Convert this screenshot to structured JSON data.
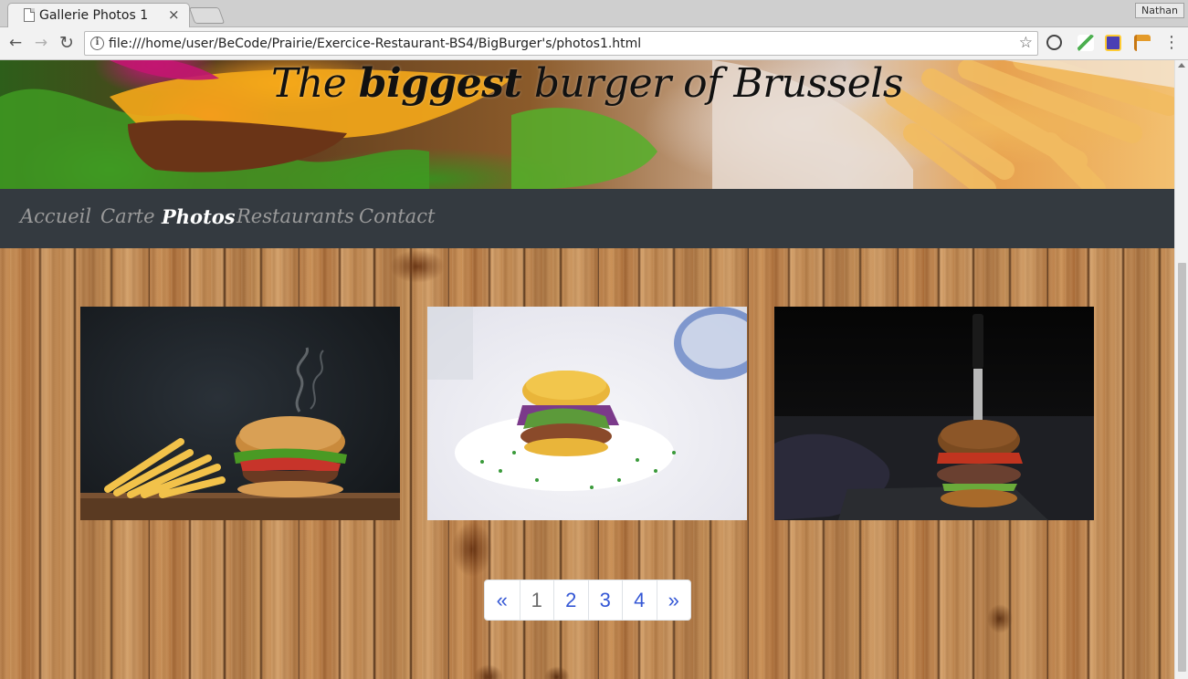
{
  "browser": {
    "tab_title": "Gallerie Photos 1",
    "tab_close": "×",
    "profile_name": "Nathan",
    "url": "file:///home/user/BeCode/Prairie/Exercice-Restaurant-BS4/BigBurger's/photos1.html",
    "icons": {
      "back": "←",
      "forward": "→",
      "reload": "↻",
      "info": "i",
      "star": "☆",
      "menu": "⋮"
    }
  },
  "header": {
    "title_start": "The",
    "title_emphasis": "biggest",
    "title_end": "burger of Brussels"
  },
  "nav": {
    "items": [
      {
        "label": "Accueil",
        "active": false
      },
      {
        "label": "Carte",
        "active": false
      },
      {
        "label": "Photos",
        "active": true
      },
      {
        "label": "Restaurants",
        "active": false
      },
      {
        "label": "Contact",
        "active": false
      }
    ]
  },
  "pagination": {
    "prev": "«",
    "pages": [
      "1",
      "2",
      "3",
      "4"
    ],
    "current": "1",
    "next": "»"
  },
  "colors": {
    "navbar_bg": "#343a40",
    "nav_link": "#9a9a9a",
    "nav_link_active": "#ffffff",
    "pagination_link": "#3457d5"
  }
}
